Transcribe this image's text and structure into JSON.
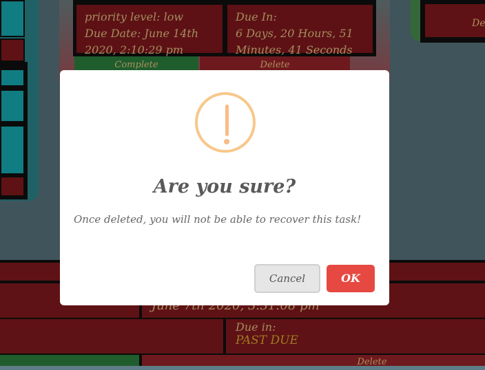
{
  "top_card": {
    "priority_text": "priority level: low",
    "due_date_text": "Due Date: June 14th 2020, 2:10:29 pm",
    "due_in_label": "Due In:",
    "due_in_value": "6 Days, 20 Hours, 51 Minutes, 41 Seconds",
    "complete_label": "Complete",
    "delete_label": "Delete"
  },
  "right_card": {
    "delete_label": "Delete"
  },
  "bottom_card": {
    "date_text": "June 7th 2020, 3:31:08 pm",
    "due_in_label": "Due in:",
    "due_in_value": "PAST DUE",
    "delete_label": "Delete"
  },
  "modal": {
    "title": "Are you sure?",
    "text": "Once deleted, you will not be able to recover this task!",
    "cancel_label": "Cancel",
    "ok_label": "OK"
  },
  "colors": {
    "page_bg": "#5f7d86",
    "card_red": "#8d1b1f",
    "teal": "#18b8c0",
    "complete_green": "#2f8a43",
    "ok_button": "#e64942",
    "warning": "#f8bb86"
  }
}
